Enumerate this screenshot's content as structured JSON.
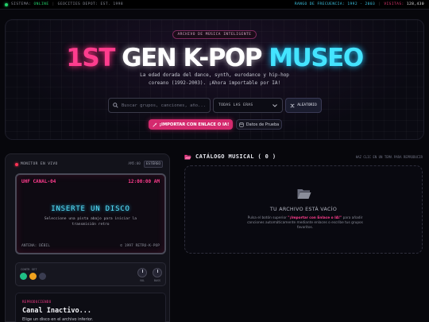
{
  "topbar": {
    "status_prefix": "SISTEMA:",
    "status_value": "ONLINE",
    "host": "GEOCITIES DEPOT: EST. 1998",
    "freq_label": "RANGO DE FRECUENCIA: 1992 - 2003",
    "visits_label": "VISITAS:",
    "visits_value": "128,430"
  },
  "hero": {
    "badge": "ARCHIVO DE MÚSICA INTELIGENTE",
    "title_part1": "1ST",
    "title_part2": "GEN K-POP",
    "title_part3": "MUSEO",
    "subtitle_line1": "La edad dorada del dance, synth, eurodance y hip-hop",
    "subtitle_line2": "coreano (1992-2003). ¡Ahora importable por IA!",
    "search_placeholder": "Buscar grupos, canciones, año...",
    "era_select": "TODAS LAS ERAS",
    "random_label": "ALEATORIO",
    "import_label": "¡IMPORTAR CON ENLACE O IA!",
    "demo_label": "Datos de Prueba"
  },
  "monitor": {
    "header": "MONITOR EN VIVO",
    "hz": "AM5:00",
    "stereo": "ESTÉREO",
    "channel": "UHF CANAL-04",
    "time": "12:00:00 AM",
    "insert": "INSERTE UN DISCO",
    "hint": "Seleccione una pista abajo para iniciar la transmisión retro",
    "antenna": "ANTENA: DÉBIL",
    "copyright": "© 1997 RETRO-K-POP",
    "controls_label": "CONTR SET",
    "knob1": "VOL",
    "knob2": "BASS",
    "playing_label": "REPRODUCIENDO",
    "playing_name": "Canal Inactivo...",
    "playing_desc": "Elige un disco en el archivo inferior."
  },
  "catalog": {
    "title": "CATÁLOGO MUSICAL ( 0 )",
    "hint": "HAZ CLIC EN UN TEMA PARA REPRODUCIR",
    "empty_title": "TU ARCHIVO ESTÁ VACÍO",
    "empty_text_a": "Pulsa el botón superior ",
    "empty_text_b": "\"¡Importar con Enlace o IA!\"",
    "empty_text_c": " para añadir canciones automáticamente mediante enlaces o escribe tus grupos favoritos."
  },
  "colors": {
    "accent_pink": "#ff3d8e",
    "accent_cyan": "#44e4ff",
    "online_green": "#22d36b"
  }
}
